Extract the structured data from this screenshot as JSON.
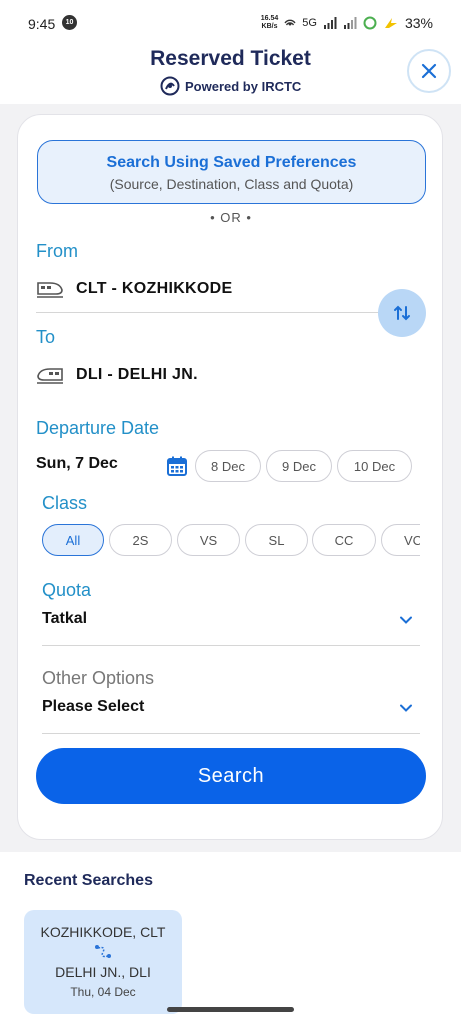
{
  "status_bar": {
    "time": "9:45",
    "badge": "10",
    "network_speed_value": "16.54",
    "network_speed_unit": "KB/s",
    "network": "5G",
    "battery": "33%"
  },
  "header": {
    "title": "Reserved Ticket",
    "subtitle": "Powered by IRCTC",
    "close_icon": "close-icon"
  },
  "preferences": {
    "title": "Search Using Saved Preferences",
    "subtitle": "(Source, Destination, Class and Quota)"
  },
  "or_text": "• OR •",
  "from": {
    "label": "From",
    "station": "CLT - KOZHIKKODE",
    "icon": "train-icon"
  },
  "to": {
    "label": "To",
    "station": "DLI - DELHI JN.",
    "icon": "train-icon"
  },
  "departure": {
    "label": "Departure Date",
    "selected": "Sun, 7 Dec",
    "chips": [
      "8 Dec",
      "9 Dec",
      "10 Dec"
    ]
  },
  "class_section": {
    "label": "Class",
    "selected": "All",
    "options": [
      "All",
      "2S",
      "VS",
      "SL",
      "CC",
      "VC"
    ]
  },
  "quota": {
    "label": "Quota",
    "value": "Tatkal"
  },
  "other_options": {
    "label": "Other Options",
    "value": "Please Select"
  },
  "search_button": "Search",
  "recent": {
    "title": "Recent Searches",
    "items": [
      {
        "from": "KOZHIKKODE, CLT",
        "to": "DELHI JN., DLI",
        "date": "Thu, 04 Dec"
      }
    ]
  },
  "colors": {
    "accent": "#0a63e8",
    "label_blue": "#2390c8",
    "navy": "#1f2a5a",
    "chip_active_bg": "#e3eefc"
  }
}
